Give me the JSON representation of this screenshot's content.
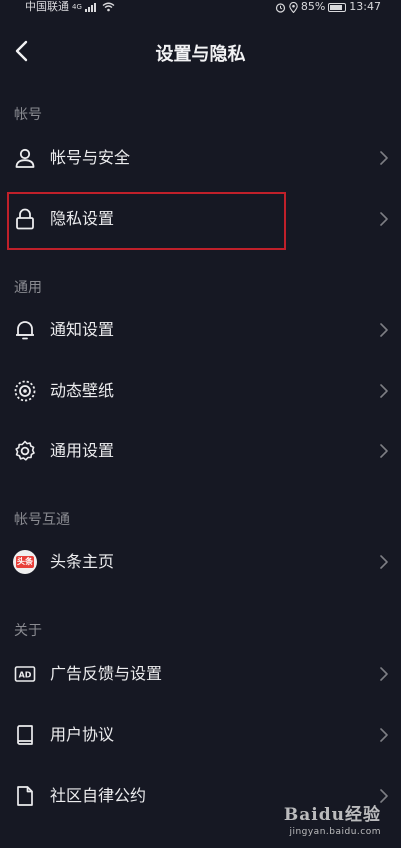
{
  "status_bar": {
    "carrier": "中国联通",
    "network": "4G",
    "battery": "85%",
    "time": "13:47"
  },
  "nav": {
    "title": "设置与隐私",
    "back_icon": "chevron-left-icon"
  },
  "sections": {
    "account": {
      "header": "帐号",
      "items": [
        {
          "label": "帐号与安全",
          "icon": "user-icon"
        },
        {
          "label": "隐私设置",
          "icon": "lock-icon"
        }
      ]
    },
    "general": {
      "header": "通用",
      "items": [
        {
          "label": "通知设置",
          "icon": "bell-icon"
        },
        {
          "label": "动态壁纸",
          "icon": "live-wallpaper-icon"
        },
        {
          "label": "通用设置",
          "icon": "gear-icon"
        }
      ]
    },
    "linked": {
      "header": "帐号互通",
      "items": [
        {
          "label": "头条主页",
          "icon": "toutiao-icon",
          "badge_text": "头条"
        }
      ]
    },
    "about": {
      "header": "关于",
      "items": [
        {
          "label": "广告反馈与设置",
          "icon": "ad-icon"
        },
        {
          "label": "用户协议",
          "icon": "book-icon"
        },
        {
          "label": "社区自律公约",
          "icon": "document-icon"
        }
      ]
    }
  },
  "colors": {
    "background": "#161823",
    "highlight": "#c0202a",
    "toutiao_red": "#e8403a"
  },
  "watermark": {
    "main": "Baidu经验",
    "sub": "jingyan.baidu.com"
  }
}
